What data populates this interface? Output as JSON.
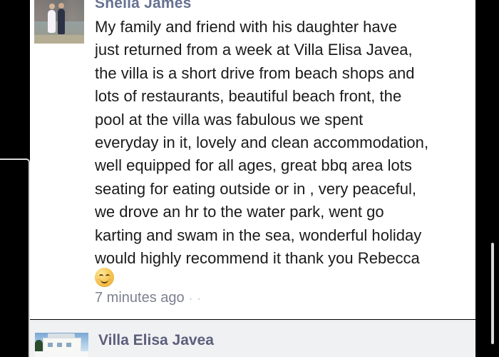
{
  "post": {
    "author": "Sheila James",
    "body": "My family and friend with his daughter have\njust returned from a week at Villa Elisa Javea,\nthe villa is a short drive from beach shops and\nlots of restaurants, beautiful beach front, the\npool at the villa was fabulous we spent\neveryday in it, lovely and clean accommodation,\nwell equipped for all ages, great bbq area lots\nseating for eating outside or in , very peaceful,\nwe drove an hr to the water park, went go\nkarting and swam in the sea, wonderful holiday\nwould highly recommend it thank you Rebecca",
    "emoji": "smiling-face-icon",
    "timestamp": "7 minutes ago",
    "more": "· ·"
  },
  "reply": {
    "author": "Villa Elisa Javea"
  },
  "colors": {
    "background": "#000000",
    "card": "#ffffff",
    "name": "#677191",
    "body": "#1a1a1a",
    "meta": "#7d8190",
    "reply_name": "#5c5f7a"
  }
}
